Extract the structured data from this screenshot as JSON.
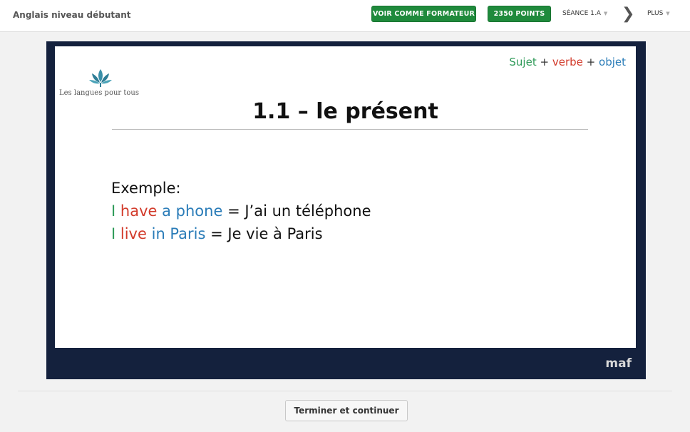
{
  "header": {
    "course_title": "Anglais niveau débutant",
    "trainer_button": "VOIR COMME FORMATEUR",
    "points_button": "2350 POINTS",
    "session_label": "SÉANCE 1.A",
    "more_label": "PLUS",
    "next_icon": "chevron-right-icon"
  },
  "slide": {
    "logo_text": "Les langues pour tous",
    "formula": {
      "subject": "Sujet",
      "plus1": "+",
      "verb": "verbe",
      "plus2": "+",
      "object": "objet"
    },
    "title": "1.1 – le présent",
    "example_label": "Exemple:",
    "example1": {
      "subject": "I",
      "verb": "have",
      "object": "a phone",
      "translation": "= J’ai un téléphone"
    },
    "example2": {
      "subject": "I",
      "verb": "live",
      "object": "in Paris",
      "translation": "= Je vie à Paris"
    },
    "footer_logo": "maf"
  },
  "footer": {
    "continue_button": "Terminer et continuer"
  },
  "colors": {
    "green_button": "#1f8a3c",
    "slide_frame": "#14213d",
    "subject": "#2e9a58",
    "verb": "#d23a2a",
    "object": "#2a7cb8"
  }
}
